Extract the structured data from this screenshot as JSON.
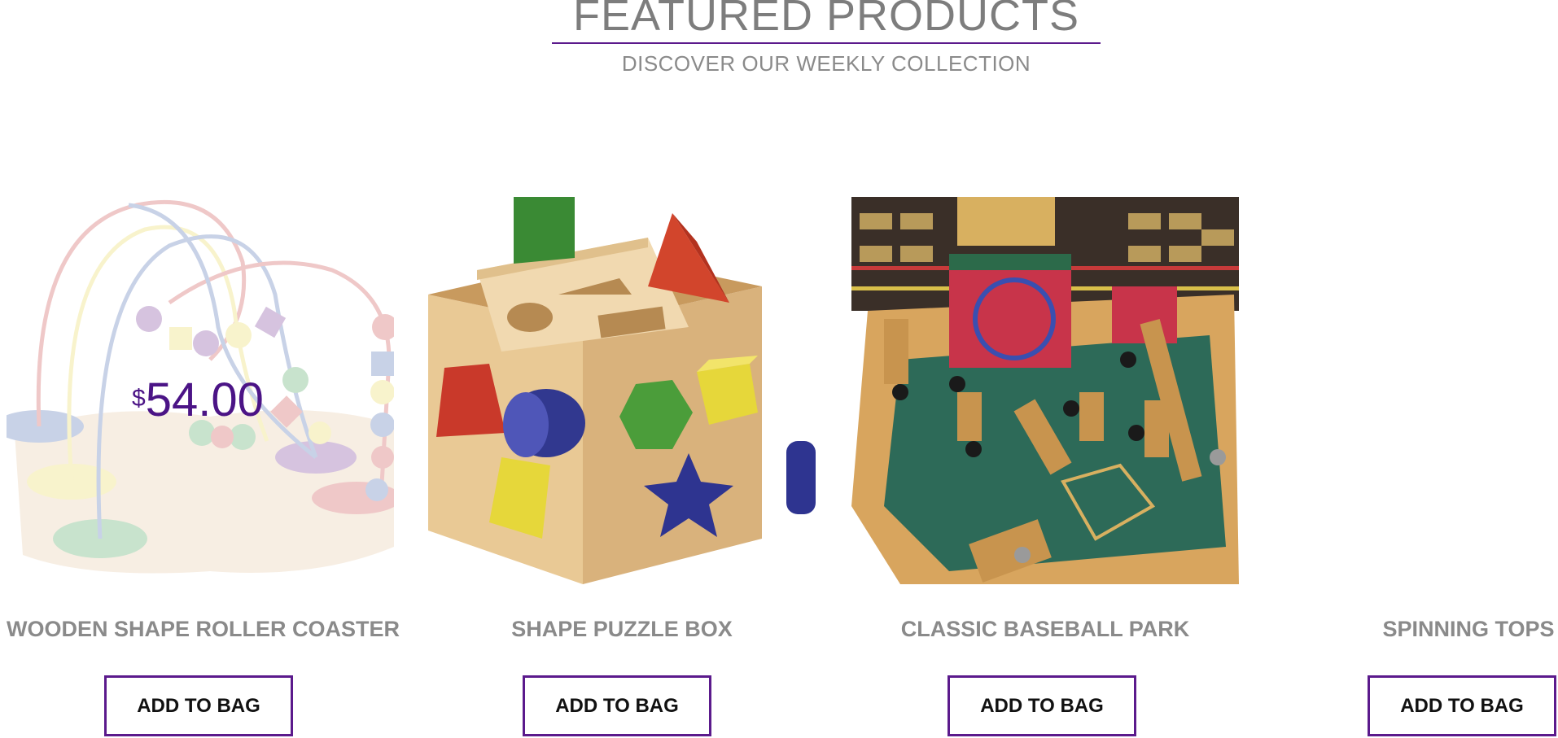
{
  "section": {
    "title": "FEATURED PRODUCTS",
    "subtitle": "DISCOVER OUR WEEKLY COLLECTION"
  },
  "products": [
    {
      "name": "WOODEN SHAPE ROLLER COASTER",
      "price_currency": "$",
      "price_amount": "54.00",
      "button_label": "ADD TO BAG",
      "image_icon": "bead-maze-toy-image"
    },
    {
      "name": "SHAPE PUZZLE BOX",
      "button_label": "ADD TO BAG",
      "image_icon": "shape-sorter-cube-image"
    },
    {
      "name": "CLASSIC BASEBALL PARK",
      "button_label": "ADD TO BAG",
      "image_icon": "pinball-baseball-game-image"
    },
    {
      "name": "SPINNING TOPS",
      "button_label": "ADD TO BAG"
    }
  ],
  "colors": {
    "accent": "#5b1a8c",
    "price": "#4b1486",
    "title_gray": "#7d7d7d"
  }
}
